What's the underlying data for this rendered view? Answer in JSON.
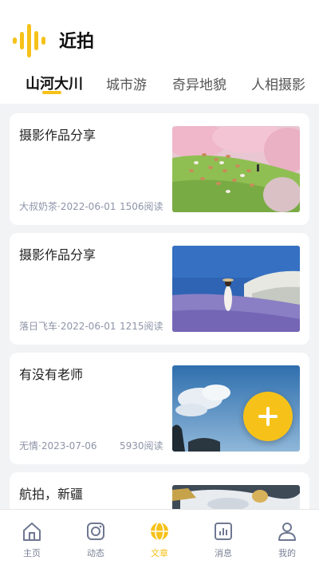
{
  "app": {
    "title": "近拍"
  },
  "tabs": [
    {
      "label": "山河大川",
      "active": true
    },
    {
      "label": "城市游",
      "active": false
    },
    {
      "label": "奇异地貌",
      "active": false
    },
    {
      "label": "人相摄影",
      "active": false
    }
  ],
  "articles": [
    {
      "title": "摄影作品分享",
      "meta": "大叔奶茶·2022-06-01",
      "reads": "1506阅读",
      "thumb": "pink-blossom-meadow-sheep"
    },
    {
      "title": "摄影作品分享",
      "meta": "落日飞车·2022-06-01",
      "reads": "1215阅读",
      "thumb": "lake-lavender-girl"
    },
    {
      "title": "有没有老师",
      "meta": "无情·2023-07-06",
      "reads": "5930阅读",
      "thumb": "blue-sky-clouds"
    },
    {
      "title": "航拍，新疆",
      "meta": "",
      "reads": "",
      "thumb": "aerial-snow-landscape"
    }
  ],
  "fab": {
    "icon": "plus-icon"
  },
  "bottom_nav": [
    {
      "label": "主页",
      "icon": "home-icon",
      "active": false
    },
    {
      "label": "动态",
      "icon": "instagram-icon",
      "active": false
    },
    {
      "label": "文章",
      "icon": "globe-icon",
      "active": true
    },
    {
      "label": "消息",
      "icon": "chart-icon",
      "active": false
    },
    {
      "label": "我的",
      "icon": "user-icon",
      "active": false
    }
  ],
  "colors": {
    "accent": "#f6c219",
    "background": "#f2f3f5",
    "muted_text": "#8e94a8"
  }
}
